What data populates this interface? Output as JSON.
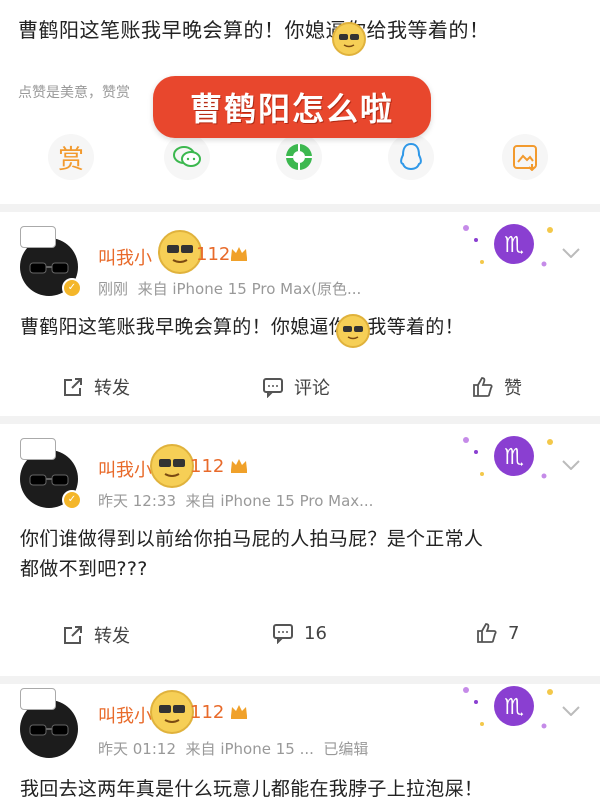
{
  "top": {
    "text": "曹鹤阳这笔账我早晚会算的！你媳逼你给我等着的！",
    "like_hint": "点赞是美意，赞赏",
    "overlay": "曹鹤阳怎么啦",
    "share": [
      "reward-icon",
      "wechat-icon",
      "moments-icon",
      "qq-icon",
      "save-image-icon"
    ],
    "reward_label": "赏"
  },
  "posts": [
    {
      "username": "叫我小",
      "username_tail": "112",
      "time": "刚刚",
      "source": "来自 iPhone 15 Pro Max(原色...",
      "text": "曹鹤阳这笔账我早晚会算的！你媳逼你给我等着的！",
      "actions": {
        "repost": "转发",
        "comment": "评论",
        "like": "赞"
      }
    },
    {
      "username": "叫我小",
      "username_tail": "112",
      "time": "昨天 12:33",
      "source": "来自 iPhone 15 Pro Max...",
      "text_line1": "你们谁做得到以前给你拍马屁的人拍马屁？是个正常人",
      "text_line2": "都做不到吧???",
      "actions": {
        "repost": "转发",
        "comment": "16",
        "like": "7"
      }
    },
    {
      "username": "叫我小",
      "username_tail": "112",
      "time": "昨天 01:12",
      "source": "来自 iPhone 15 ...",
      "edited": "已编辑",
      "text": "我回去这两年真是什么玩意儿都能在我脖子上拉泡屎！"
    }
  ],
  "colors": {
    "accent": "#e8472d",
    "username": "#e86a2a",
    "reward": "#f29a2e",
    "zodiac": "#8a3fd1"
  }
}
